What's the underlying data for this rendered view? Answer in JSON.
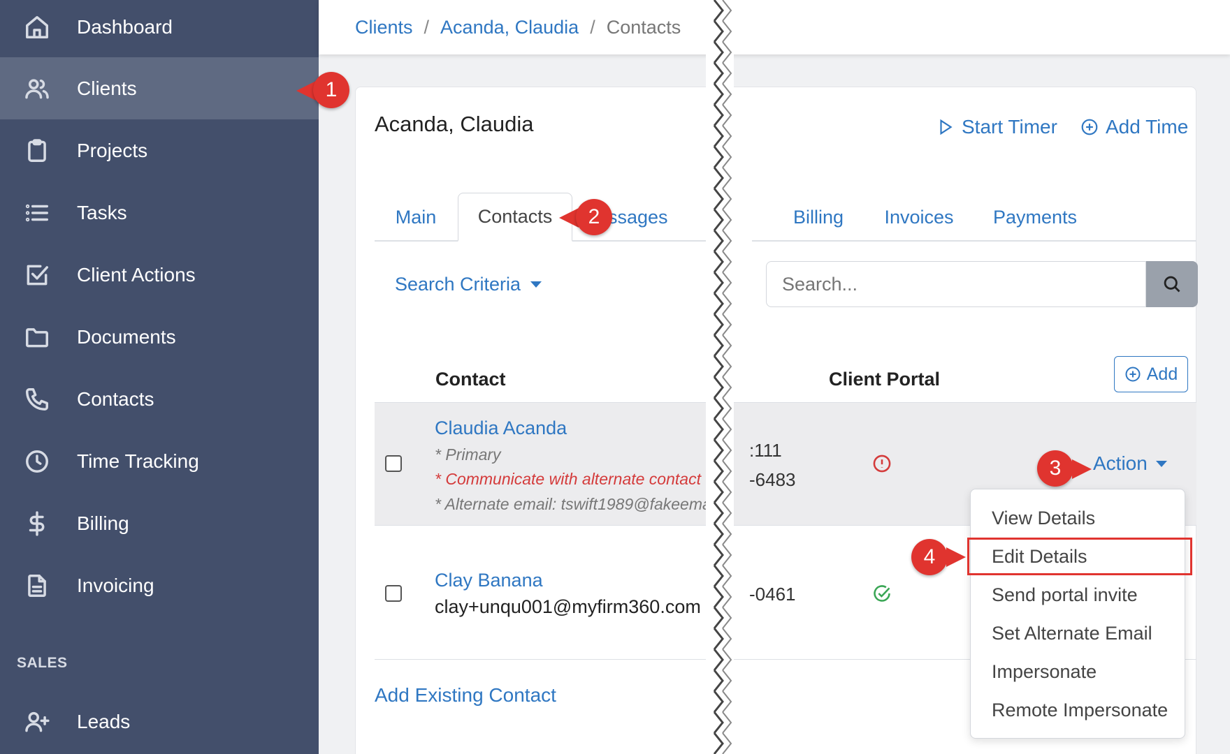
{
  "sidebar": {
    "items": [
      {
        "label": "Dashboard",
        "icon": "home-icon"
      },
      {
        "label": "Clients",
        "icon": "users-icon",
        "active": true
      },
      {
        "label": "Projects",
        "icon": "clipboard-icon"
      },
      {
        "label": "Tasks",
        "icon": "list-icon"
      },
      {
        "label": "Client Actions",
        "icon": "checkbox-icon"
      },
      {
        "label": "Documents",
        "icon": "folder-icon"
      },
      {
        "label": "Contacts",
        "icon": "phone-icon"
      },
      {
        "label": "Time Tracking",
        "icon": "clock-icon"
      },
      {
        "label": "Billing",
        "icon": "dollar-icon"
      },
      {
        "label": "Invoicing",
        "icon": "file-text-icon"
      }
    ],
    "sales_header": "SALES",
    "sales_items": [
      {
        "label": "Leads",
        "icon": "user-plus-icon"
      }
    ]
  },
  "breadcrumb": {
    "items": [
      "Clients",
      "Acanda, Claudia"
    ],
    "separator": "/",
    "current": "Contacts"
  },
  "client": {
    "name": "Acanda, Claudia"
  },
  "header_actions": {
    "start_timer": "Start Timer",
    "add_time": "Add Time"
  },
  "tabs": {
    "main": "Main",
    "contacts": "Contacts",
    "messages": "ssages",
    "billing": "Billing",
    "invoices": "Invoices",
    "payments": "Payments"
  },
  "search": {
    "criteria_label": "Search Criteria",
    "placeholder": "Search..."
  },
  "table": {
    "col_contact": "Contact",
    "col_portal": "Client Portal",
    "add_label": "Add",
    "rows": [
      {
        "name": "Claudia Acanda",
        "notes": [
          "* Primary",
          "* Communicate with alternate contact",
          "* Alternate email: tswift1989@fakeema"
        ],
        "phones": [
          ":111",
          "-6483"
        ],
        "portal_status": "warning"
      },
      {
        "name": "Clay Banana",
        "email": "clay+unqu001@myfirm360.com",
        "phones": [
          "-0461"
        ],
        "portal_status": "ok"
      }
    ]
  },
  "action": {
    "label": "Action",
    "menu": [
      "View Details",
      "Edit Details",
      "Send portal invite",
      "Set Alternate Email",
      "Impersonate",
      "Remote Impersonate"
    ]
  },
  "add_existing": "Add Existing Contact",
  "callouts": [
    "1",
    "2",
    "3",
    "4"
  ],
  "colors": {
    "sidebar_bg": "#434f6b",
    "sidebar_active": "#5f6a82",
    "link": "#2f77c2",
    "callout": "#e0342f",
    "warning": "#d43b3b",
    "success": "#3aa655"
  }
}
